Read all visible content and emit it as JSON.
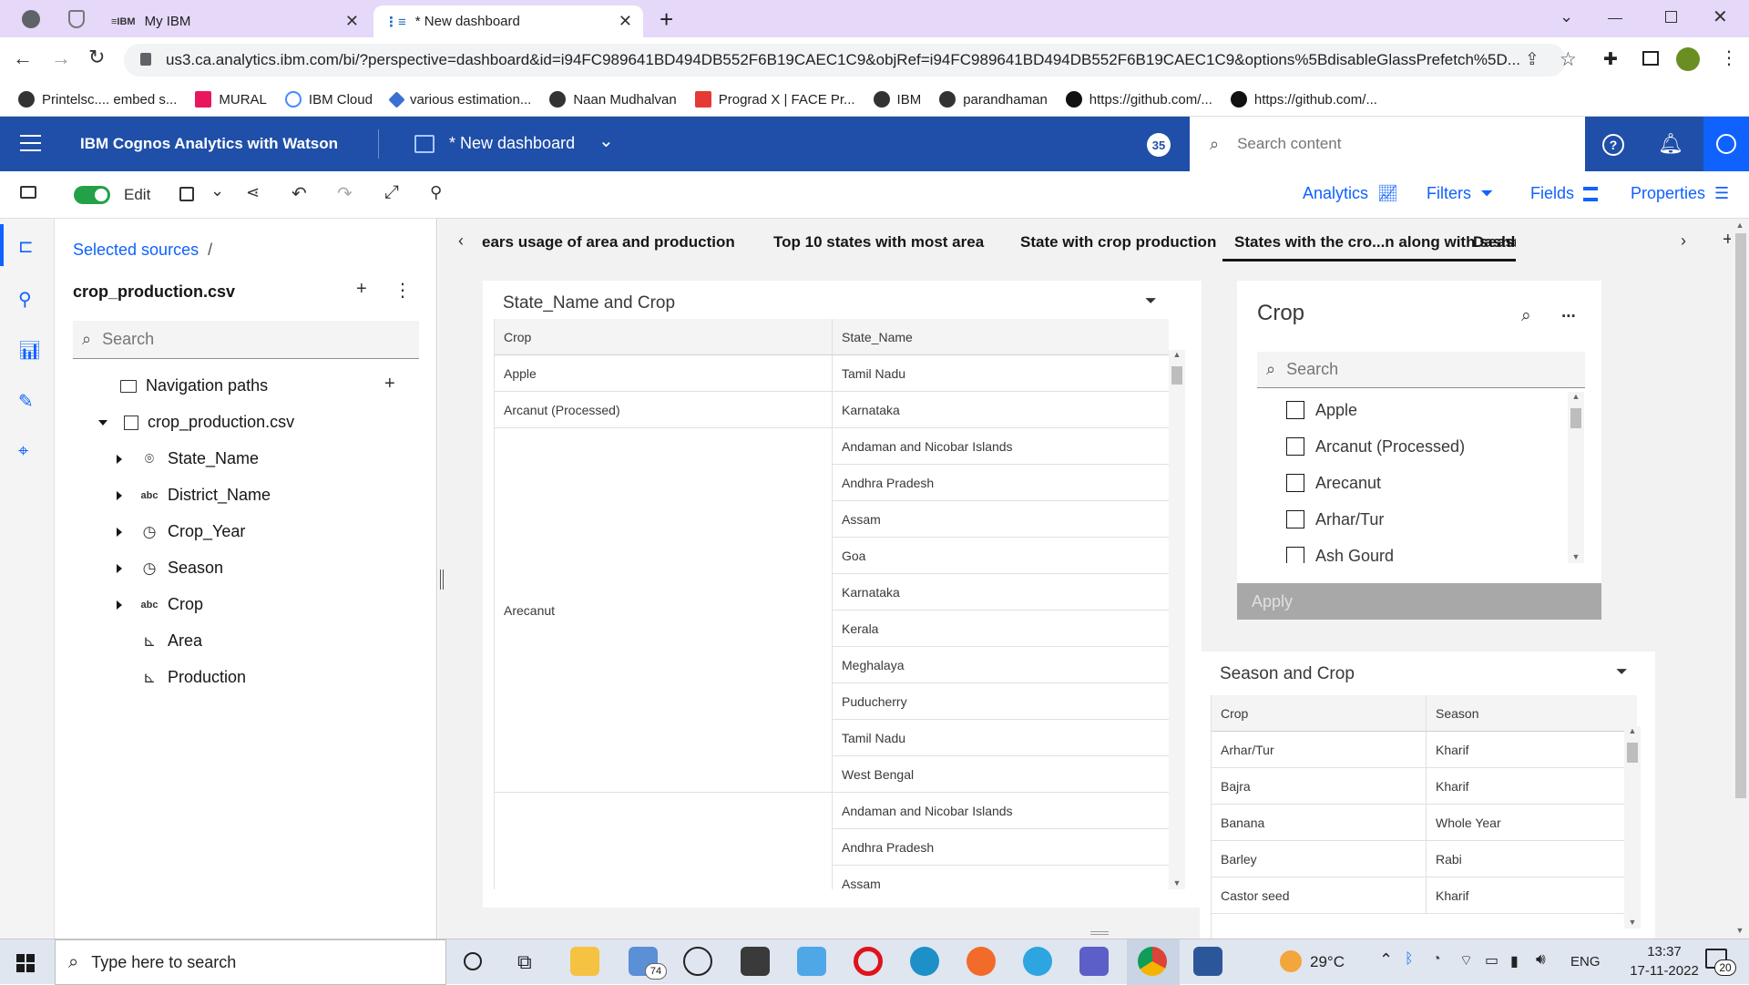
{
  "browser": {
    "tabs": [
      {
        "label": "My IBM"
      },
      {
        "label": "* New dashboard"
      }
    ],
    "url": "us3.ca.analytics.ibm.com/bi/?perspective=dashboard&id=i94FC989641BD494DB552F6B19CAEC1C9&objRef=i94FC989641BD494DB552F6B19CAEC1C9&options%5BdisableGlassPrefetch%5D...",
    "bookmarks": [
      {
        "label": "Printelsc.... embed s..."
      },
      {
        "label": "MURAL"
      },
      {
        "label": "IBM Cloud"
      },
      {
        "label": "various estimation..."
      },
      {
        "label": "Naan Mudhalvan"
      },
      {
        "label": "Prograd X | FACE Pr..."
      },
      {
        "label": "IBM"
      },
      {
        "label": "parandhaman"
      },
      {
        "label": "https://github.com/..."
      },
      {
        "label": "https://github.com/..."
      }
    ]
  },
  "app": {
    "title": "IBM Cognos Analytics with Watson",
    "dashboard_title": "* New dashboard",
    "notification_count": "35",
    "search_placeholder": "Search content"
  },
  "toolbar": {
    "edit_label": "Edit",
    "analytics_label": "Analytics",
    "filters_label": "Filters",
    "fields_label": "Fields",
    "properties_label": "Properties"
  },
  "sources": {
    "breadcrumb": "Selected sources",
    "breadcrumb_sep": "/",
    "file_name": "crop_production.csv",
    "search_placeholder": "Search",
    "nav_paths": "Navigation paths",
    "table_name": "crop_production.csv",
    "fields": [
      {
        "label": "State_Name",
        "icon": "location-icon",
        "expandable": true
      },
      {
        "label": "District_Name",
        "icon": "abc-icon",
        "expandable": true
      },
      {
        "label": "Crop_Year",
        "icon": "clock-icon",
        "expandable": true
      },
      {
        "label": "Season",
        "icon": "clock-icon",
        "expandable": true
      },
      {
        "label": "Crop",
        "icon": "abc-icon",
        "expandable": true
      },
      {
        "label": "Area",
        "icon": "measure-icon",
        "expandable": false
      },
      {
        "label": "Production",
        "icon": "measure-icon",
        "expandable": false
      }
    ]
  },
  "dashboard_tabs": [
    {
      "label": "ears usage of area and production"
    },
    {
      "label": "Top 10 states with most area"
    },
    {
      "label": "State with crop production"
    },
    {
      "label": "States with the cro...n along with season"
    },
    {
      "label": "Dashbo"
    }
  ],
  "widget_state_crop": {
    "title": "State_Name and Crop",
    "columns": [
      "Crop",
      "State_Name"
    ],
    "rows": [
      {
        "crop": "Apple",
        "states": [
          "Tamil Nadu"
        ]
      },
      {
        "crop": "Arcanut (Processed)",
        "states": [
          "Karnataka"
        ]
      },
      {
        "crop": "Arecanut",
        "states": [
          "Andaman and Nicobar Islands",
          "Andhra Pradesh",
          "Assam",
          "Goa",
          "Karnataka",
          "Kerala",
          "Meghalaya",
          "Puducherry",
          "Tamil Nadu",
          "West Bengal"
        ]
      },
      {
        "crop": "",
        "states": [
          "Andaman and Nicobar Islands",
          "Andhra Pradesh",
          "Assam"
        ]
      }
    ]
  },
  "filter_crop": {
    "title": "Crop",
    "search_placeholder": "Search",
    "options": [
      "Apple",
      "Arcanut (Processed)",
      "Arecanut",
      "Arhar/Tur",
      "Ash Gourd"
    ],
    "apply_label": "Apply",
    "more_label": "..."
  },
  "widget_season_crop": {
    "title": "Season and Crop",
    "columns": [
      "Crop",
      "Season"
    ],
    "rows": [
      [
        "Arhar/Tur",
        "Kharif"
      ],
      [
        "Bajra",
        "Kharif"
      ],
      [
        "Banana",
        "Whole Year"
      ],
      [
        "Barley",
        "Rabi"
      ],
      [
        "Castor seed",
        "Kharif"
      ]
    ]
  },
  "taskbar": {
    "search_placeholder": "Type here to search",
    "mail_badge": "74",
    "weather": "29°C",
    "language": "ENG",
    "time": "13:37",
    "date": "17-11-2022",
    "notif_count": "20"
  },
  "colors": {
    "ibm_blue": "#1f4fa8",
    "link_blue": "#0f62fe",
    "tab_strip": "#e5d8f8",
    "toggle_green": "#24a148"
  }
}
